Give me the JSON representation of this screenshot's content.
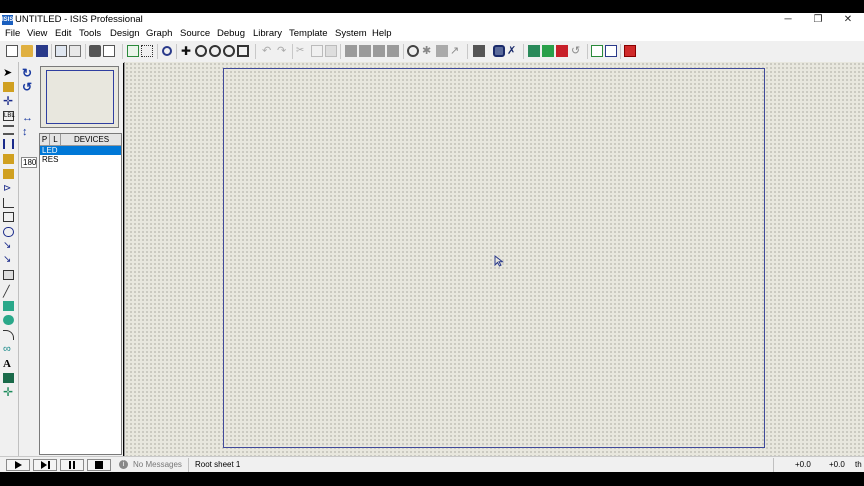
{
  "window": {
    "app_icon_text": "ISIS",
    "title": "UNTITLED - ISIS Professional",
    "minimize_glyph": "─",
    "restore_glyph": "❐",
    "close_glyph": "✕"
  },
  "menu": [
    "File",
    "View",
    "Edit",
    "Tools",
    "Design",
    "Graph",
    "Source",
    "Debug",
    "Library",
    "Template",
    "System",
    "Help"
  ],
  "rotation": {
    "value": "180"
  },
  "device_panel": {
    "p_button": "P",
    "l_button": "L",
    "title": "DEVICES",
    "items": [
      "LED",
      "RES"
    ],
    "selected_index": 0
  },
  "status": {
    "messages": "No Messages",
    "sheet": "Root sheet 1",
    "x_coord": "+0.0",
    "y_coord": "+0.0",
    "unit": "th"
  },
  "colors": {
    "selection": "#0078d7",
    "canvas": "#e8e7de",
    "sheet_border": "#404a9a"
  }
}
